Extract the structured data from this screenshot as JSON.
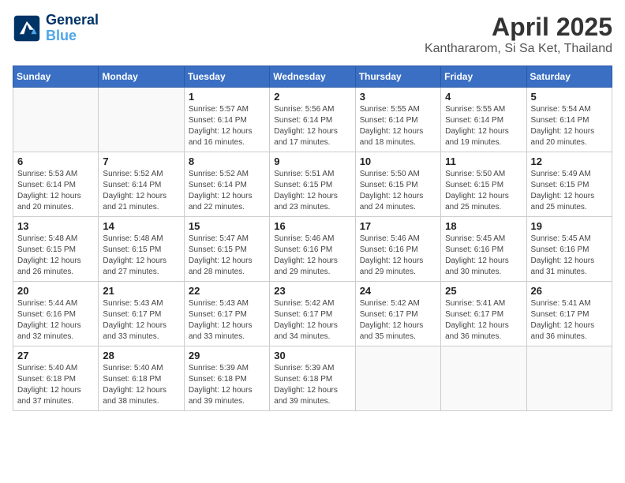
{
  "header": {
    "logo_line1": "General",
    "logo_line2": "Blue",
    "main_title": "April 2025",
    "subtitle": "Kanthararom, Si Sa Ket, Thailand"
  },
  "weekdays": [
    "Sunday",
    "Monday",
    "Tuesday",
    "Wednesday",
    "Thursday",
    "Friday",
    "Saturday"
  ],
  "weeks": [
    [
      {
        "day": "",
        "info": ""
      },
      {
        "day": "",
        "info": ""
      },
      {
        "day": "1",
        "info": "Sunrise: 5:57 AM\nSunset: 6:14 PM\nDaylight: 12 hours and 16 minutes."
      },
      {
        "day": "2",
        "info": "Sunrise: 5:56 AM\nSunset: 6:14 PM\nDaylight: 12 hours and 17 minutes."
      },
      {
        "day": "3",
        "info": "Sunrise: 5:55 AM\nSunset: 6:14 PM\nDaylight: 12 hours and 18 minutes."
      },
      {
        "day": "4",
        "info": "Sunrise: 5:55 AM\nSunset: 6:14 PM\nDaylight: 12 hours and 19 minutes."
      },
      {
        "day": "5",
        "info": "Sunrise: 5:54 AM\nSunset: 6:14 PM\nDaylight: 12 hours and 20 minutes."
      }
    ],
    [
      {
        "day": "6",
        "info": "Sunrise: 5:53 AM\nSunset: 6:14 PM\nDaylight: 12 hours and 20 minutes."
      },
      {
        "day": "7",
        "info": "Sunrise: 5:52 AM\nSunset: 6:14 PM\nDaylight: 12 hours and 21 minutes."
      },
      {
        "day": "8",
        "info": "Sunrise: 5:52 AM\nSunset: 6:14 PM\nDaylight: 12 hours and 22 minutes."
      },
      {
        "day": "9",
        "info": "Sunrise: 5:51 AM\nSunset: 6:15 PM\nDaylight: 12 hours and 23 minutes."
      },
      {
        "day": "10",
        "info": "Sunrise: 5:50 AM\nSunset: 6:15 PM\nDaylight: 12 hours and 24 minutes."
      },
      {
        "day": "11",
        "info": "Sunrise: 5:50 AM\nSunset: 6:15 PM\nDaylight: 12 hours and 25 minutes."
      },
      {
        "day": "12",
        "info": "Sunrise: 5:49 AM\nSunset: 6:15 PM\nDaylight: 12 hours and 25 minutes."
      }
    ],
    [
      {
        "day": "13",
        "info": "Sunrise: 5:48 AM\nSunset: 6:15 PM\nDaylight: 12 hours and 26 minutes."
      },
      {
        "day": "14",
        "info": "Sunrise: 5:48 AM\nSunset: 6:15 PM\nDaylight: 12 hours and 27 minutes."
      },
      {
        "day": "15",
        "info": "Sunrise: 5:47 AM\nSunset: 6:15 PM\nDaylight: 12 hours and 28 minutes."
      },
      {
        "day": "16",
        "info": "Sunrise: 5:46 AM\nSunset: 6:16 PM\nDaylight: 12 hours and 29 minutes."
      },
      {
        "day": "17",
        "info": "Sunrise: 5:46 AM\nSunset: 6:16 PM\nDaylight: 12 hours and 29 minutes."
      },
      {
        "day": "18",
        "info": "Sunrise: 5:45 AM\nSunset: 6:16 PM\nDaylight: 12 hours and 30 minutes."
      },
      {
        "day": "19",
        "info": "Sunrise: 5:45 AM\nSunset: 6:16 PM\nDaylight: 12 hours and 31 minutes."
      }
    ],
    [
      {
        "day": "20",
        "info": "Sunrise: 5:44 AM\nSunset: 6:16 PM\nDaylight: 12 hours and 32 minutes."
      },
      {
        "day": "21",
        "info": "Sunrise: 5:43 AM\nSunset: 6:17 PM\nDaylight: 12 hours and 33 minutes."
      },
      {
        "day": "22",
        "info": "Sunrise: 5:43 AM\nSunset: 6:17 PM\nDaylight: 12 hours and 33 minutes."
      },
      {
        "day": "23",
        "info": "Sunrise: 5:42 AM\nSunset: 6:17 PM\nDaylight: 12 hours and 34 minutes."
      },
      {
        "day": "24",
        "info": "Sunrise: 5:42 AM\nSunset: 6:17 PM\nDaylight: 12 hours and 35 minutes."
      },
      {
        "day": "25",
        "info": "Sunrise: 5:41 AM\nSunset: 6:17 PM\nDaylight: 12 hours and 36 minutes."
      },
      {
        "day": "26",
        "info": "Sunrise: 5:41 AM\nSunset: 6:17 PM\nDaylight: 12 hours and 36 minutes."
      }
    ],
    [
      {
        "day": "27",
        "info": "Sunrise: 5:40 AM\nSunset: 6:18 PM\nDaylight: 12 hours and 37 minutes."
      },
      {
        "day": "28",
        "info": "Sunrise: 5:40 AM\nSunset: 6:18 PM\nDaylight: 12 hours and 38 minutes."
      },
      {
        "day": "29",
        "info": "Sunrise: 5:39 AM\nSunset: 6:18 PM\nDaylight: 12 hours and 39 minutes."
      },
      {
        "day": "30",
        "info": "Sunrise: 5:39 AM\nSunset: 6:18 PM\nDaylight: 12 hours and 39 minutes."
      },
      {
        "day": "",
        "info": ""
      },
      {
        "day": "",
        "info": ""
      },
      {
        "day": "",
        "info": ""
      }
    ]
  ]
}
